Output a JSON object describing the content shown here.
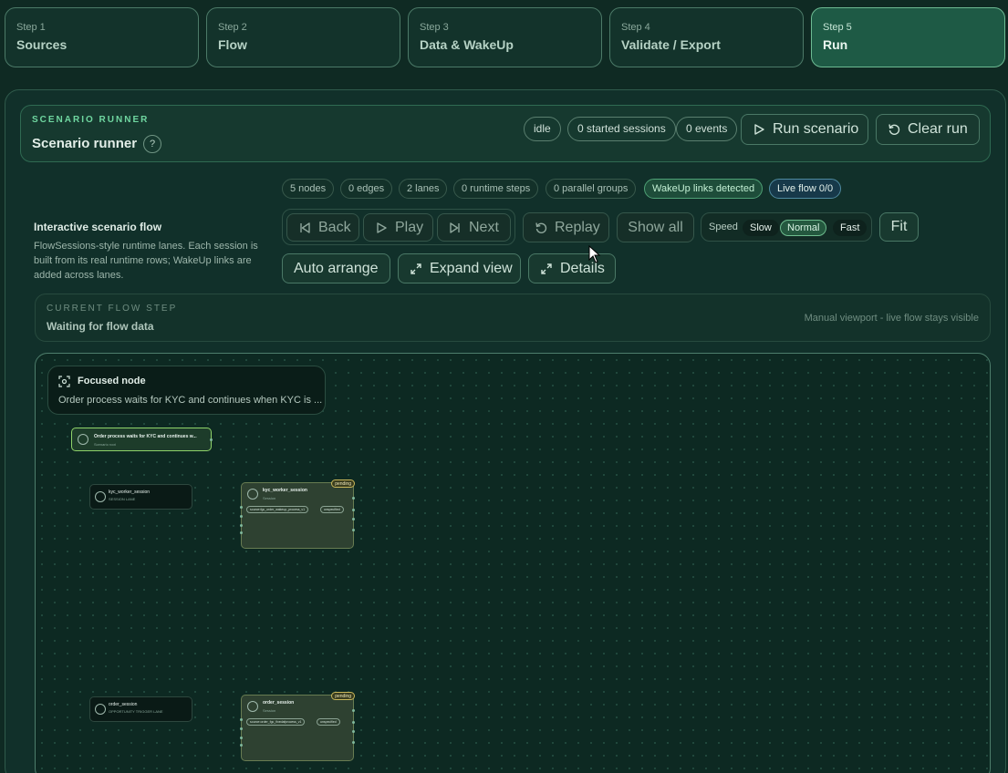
{
  "steps": [
    {
      "num": "Step 1",
      "label": "Sources"
    },
    {
      "num": "Step 2",
      "label": "Flow"
    },
    {
      "num": "Step 3",
      "label": "Data & WakeUp"
    },
    {
      "num": "Step 4",
      "label": "Validate / Export"
    },
    {
      "num": "Step 5",
      "label": "Run"
    }
  ],
  "runner": {
    "eyebrow": "SCENARIO RUNNER",
    "title": "Scenario runner",
    "help": "?",
    "status": "idle",
    "sessions": "0 started sessions",
    "events": "0 events",
    "run_label": "Run scenario",
    "clear_label": "Clear run"
  },
  "stats": {
    "nodes": "5 nodes",
    "edges": "0 edges",
    "lanes": "2 lanes",
    "runtime_steps": "0 runtime steps",
    "parallel_groups": "0 parallel groups",
    "wakeup": "WakeUp links detected",
    "live_flow": "Live flow 0/0"
  },
  "flow": {
    "title": "Interactive scenario flow",
    "description": "FlowSessions-style runtime lanes. Each session is built from its real runtime rows; WakeUp links are added across lanes."
  },
  "controls": {
    "back": "Back",
    "play": "Play",
    "next": "Next",
    "replay": "Replay",
    "show_all": "Show all",
    "speed_label": "Speed",
    "speed_options": [
      "Slow",
      "Normal",
      "Fast"
    ],
    "speed_selected": "Normal",
    "fit": "Fit",
    "auto_arrange": "Auto arrange",
    "expand_view": "Expand view",
    "details": "Details"
  },
  "current_step": {
    "eyebrow": "CURRENT FLOW STEP",
    "value": "Waiting for flow data",
    "note": "Manual viewport - live flow stays visible"
  },
  "canvas": {
    "focused_title": "Focused node",
    "focused_desc": "Order process waits for KYC and continues when KYC is ...",
    "root_title": "Order process waits for KYC and continues w...",
    "root_sub": "Scenario root",
    "lanes": [
      {
        "title": "kyc_worker_session",
        "sub": "SESSION LANE"
      },
      {
        "title": "order_session",
        "sub": "OPPORTUNITY TRIGGER LANE"
      }
    ],
    "sessions": [
      {
        "title": "kyc_worker_session",
        "sub": "Session",
        "badge": "pending",
        "tag1": "source:fgc_order_wakeup_process_v1",
        "tag2": "unspecified"
      },
      {
        "title": "order_session",
        "sub": "Session",
        "badge": "pending",
        "tag1": "source:order_fgc_fixedafprocess_v1",
        "tag2": "unspecified"
      }
    ]
  },
  "colors": {
    "accent": "#6fd6a0",
    "active_step": "#1e5a45",
    "pending": "#c8b65a",
    "background": "#0f2a23"
  }
}
